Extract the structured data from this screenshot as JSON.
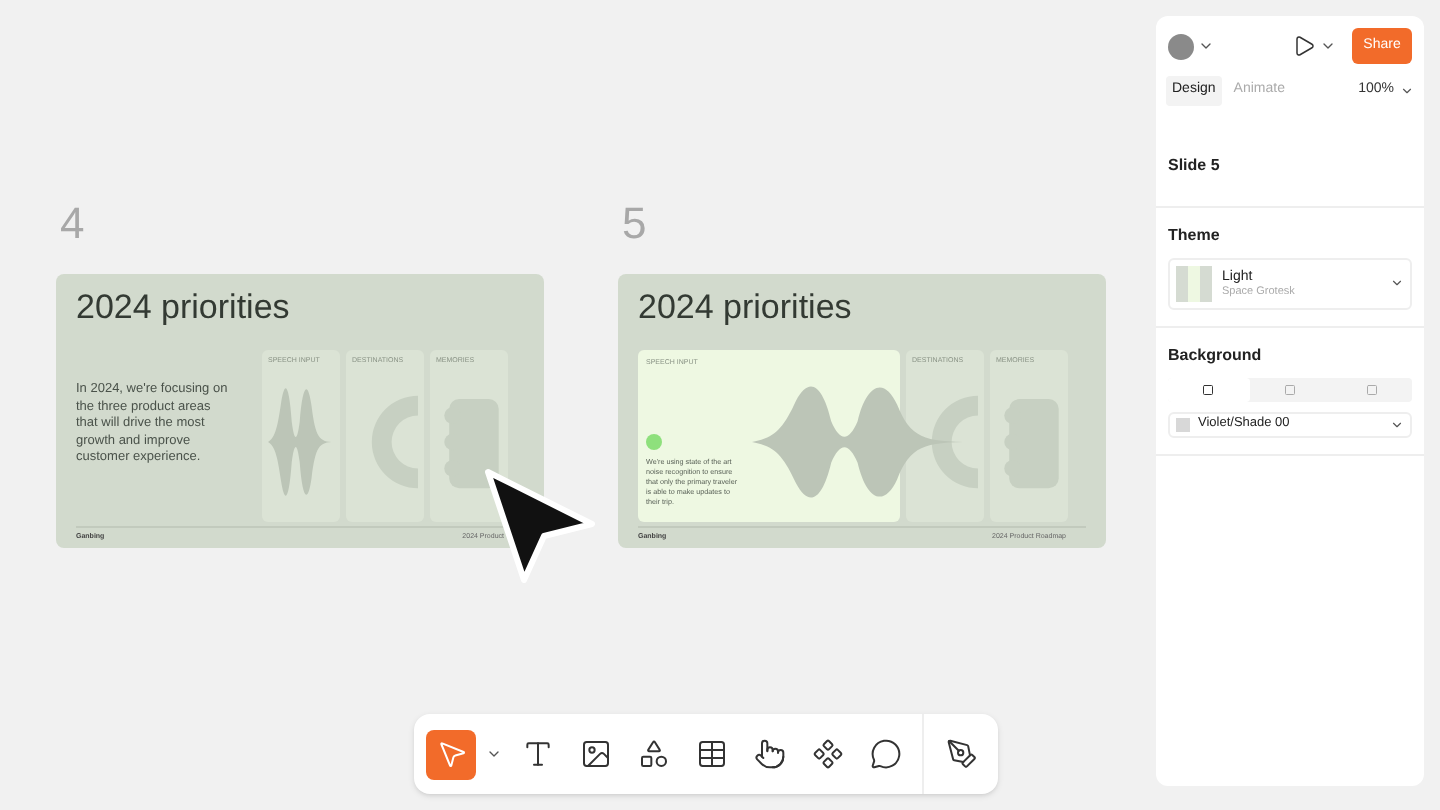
{
  "slides": [
    {
      "number": "4",
      "title": "2024 priorities",
      "body": "In 2024, we're focusing on the three product areas that will drive the most growth and improve customer experience.",
      "cards": [
        {
          "kind": "wave",
          "label": "SPEECH INPUT",
          "expanded": false
        },
        {
          "kind": "arc",
          "label": "DESTINATIONS",
          "expanded": false
        },
        {
          "kind": "pins",
          "label": "MEMORIES",
          "expanded": false
        }
      ],
      "footer_left": "Ganbing",
      "footer_right": "2024 Product"
    },
    {
      "number": "5",
      "title": "2024 priorities",
      "cards": [
        {
          "kind": "wave",
          "label": "SPEECH INPUT",
          "expanded": true,
          "text": "We're using state of the art noise recognition to ensure that only the primary traveler is able to make updates to their trip."
        },
        {
          "kind": "arc",
          "label": "DESTINATIONS",
          "expanded": false
        },
        {
          "kind": "pins",
          "label": "MEMORIES",
          "expanded": false
        }
      ],
      "footer_left": "Ganbing",
      "footer_right": "2024 Product Roadmap"
    }
  ],
  "toolbar": [
    {
      "kind": "select",
      "selected": true
    },
    {
      "kind": "text",
      "selected": false
    },
    {
      "kind": "image",
      "selected": false
    },
    {
      "kind": "shapes",
      "selected": false
    },
    {
      "kind": "table",
      "selected": false
    },
    {
      "kind": "tap",
      "selected": false
    },
    {
      "kind": "component",
      "selected": false
    },
    {
      "kind": "comment",
      "selected": false
    },
    {
      "kind": "pen",
      "selected": false
    }
  ],
  "panel": {
    "share": "Share",
    "tabs": [
      {
        "label": "Design",
        "selected": true
      },
      {
        "label": "Animate",
        "selected": false
      }
    ],
    "zoom": "100%",
    "slide_title": "Slide 5",
    "theme": {
      "heading": "Theme",
      "name": "Light",
      "font": "Space Grotesk"
    },
    "background": {
      "heading": "Background",
      "modes": [
        {
          "selected": true
        },
        {
          "selected": false
        },
        {
          "selected": false
        }
      ],
      "fill": "Violet/Shade 00"
    }
  }
}
